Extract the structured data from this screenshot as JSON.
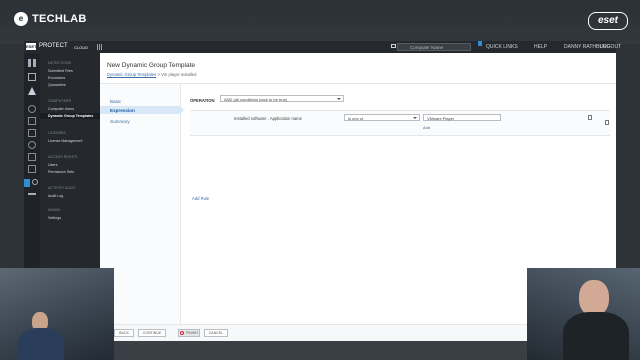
{
  "studio": {
    "brand_left": "TECHLAB",
    "brand_right": "eset"
  },
  "topbar": {
    "logo": "ESET",
    "product": "PROTECT",
    "product_suffix": "CLOUD",
    "search_placeholder": "Computer Name",
    "links": [
      "QUICK LINKS",
      "HELP",
      "DANNY RATHBURG",
      "LOGOUT"
    ]
  },
  "sidebar": {
    "sections": [
      {
        "title": "DETECTIONS",
        "items": [
          "Submitted Files",
          "Exclusions",
          "Quarantine"
        ]
      },
      {
        "title": "COMPUTERS",
        "items": [
          "Computer Users",
          "Dynamic Group Templates"
        ]
      },
      {
        "title": "LICENSES",
        "items": [
          "License Management"
        ]
      },
      {
        "title": "ACCESS RIGHTS",
        "items": [
          "Users",
          "Permission Sets"
        ]
      },
      {
        "title": "ACTIVITY AUDIT",
        "items": [
          "Audit Log"
        ]
      },
      {
        "title": "ADMIN",
        "items": [
          "Settings"
        ]
      }
    ],
    "active_item": "Dynamic Group Templates"
  },
  "page": {
    "title": "New Dynamic Group Template",
    "breadcrumb_link": "Dynamic Group Templates",
    "breadcrumb_sep": ">",
    "breadcrumb_current": "Vm player installed"
  },
  "steps": [
    "Basic",
    "Expression",
    "Summary"
  ],
  "active_step": "Expression",
  "form": {
    "operation_label": "OPERATION",
    "operation_value": "AND (all conditions have to be true)",
    "rule": {
      "field": "Installed software . Application name",
      "operator": "is one of",
      "value": "VMware Player",
      "add_label": "Add"
    },
    "add_rule": "Add Rule"
  },
  "footer": {
    "buttons": [
      "BACK",
      "CONTINUE",
      "FINISH",
      "CANCEL"
    ]
  },
  "colors": {
    "accent": "#3a6ea5",
    "sidebar_bg": "#25292e",
    "active_step_bg": "#d9e8f7"
  }
}
